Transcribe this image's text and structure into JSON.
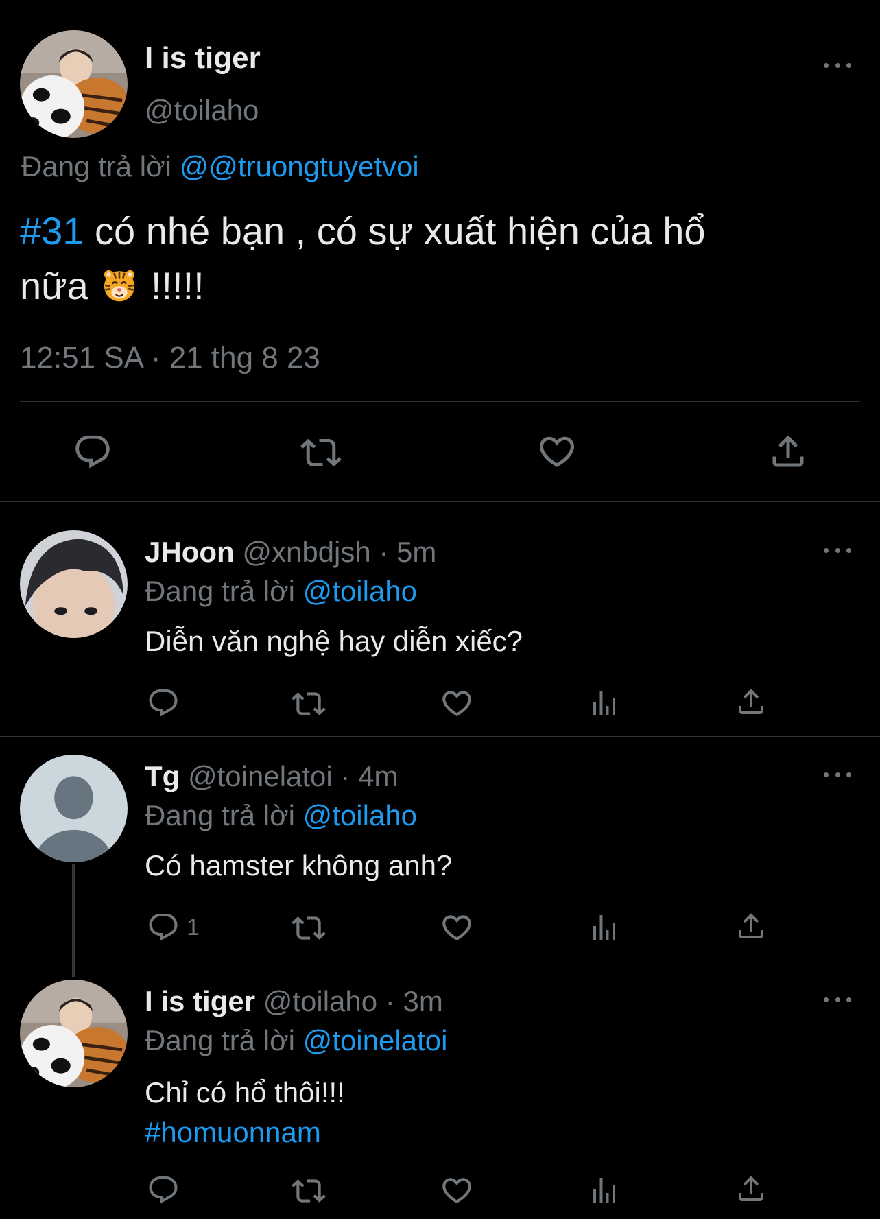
{
  "main_tweet": {
    "name": "I is tiger",
    "handle": "@toilaho",
    "reply_prefix": "Đang trả lời",
    "reply_target": "@@truongtuyetvoi",
    "hashtag": "#31",
    "text_line1": " có nhé bạn , có sự xuất hiện của hổ",
    "text_line2_a": "nữa",
    "emoji": "🐯",
    "text_line2_b": " !!!!!",
    "timestamp": "12:51 SA · 21 thg 8 23"
  },
  "replies": [
    {
      "name": "JHoon",
      "handle_time": "@xnbdjsh · 5m",
      "reply_prefix": "Đang trả lời",
      "reply_target": "@toilaho",
      "text": "Diễn văn nghệ hay diễn xiếc?",
      "reply_count": ""
    },
    {
      "name": "Tg",
      "handle_time": "@toinelatoi · 4m",
      "reply_prefix": "Đang trả lời",
      "reply_target": "@toilaho",
      "text": "Có hamster không anh?",
      "reply_count": "1"
    },
    {
      "name": "I is tiger",
      "handle_time": "@toilaho · 3m",
      "reply_prefix": "Đang trả lời",
      "reply_target": "@toinelatoi",
      "text": "Chỉ có hổ thôi!!!",
      "hashtag": "#homuonnam",
      "reply_count": ""
    }
  ],
  "colors": {
    "background": "#000000",
    "text": "#e7e9ea",
    "secondary": "#71767b",
    "link": "#1d9bf0",
    "divider": "#2f3336"
  },
  "icons": [
    "reply-icon",
    "retweet-icon",
    "like-icon",
    "views-icon",
    "share-icon",
    "more-icon"
  ]
}
